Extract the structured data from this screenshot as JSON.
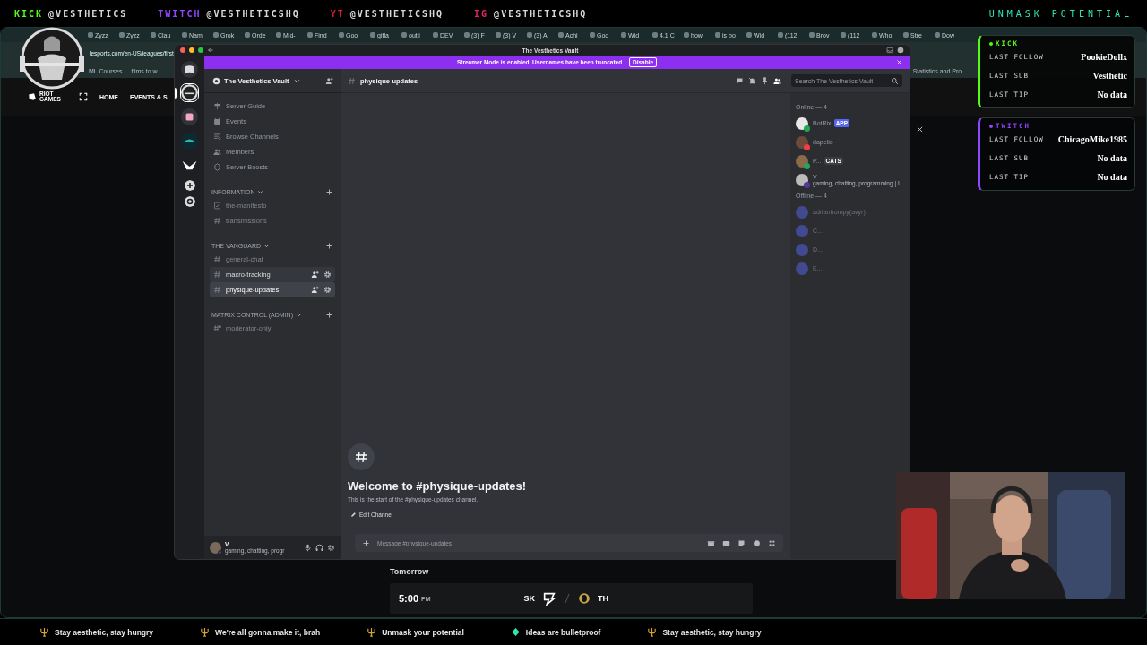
{
  "overlay_header": {
    "socials": [
      {
        "platform": "KICK",
        "handle": "@VESTHETICS",
        "color": "#53fc18"
      },
      {
        "platform": "TWITCH",
        "handle": "@VESTHETICSHQ",
        "color": "#9146ff"
      },
      {
        "platform": "YT",
        "handle": "@VESTHETICSHQ",
        "color": "#e0202a"
      },
      {
        "platform": "IG",
        "handle": "@VESTHETICSHQ",
        "color": "#e8206e"
      }
    ],
    "slogan": "UNMASK POTENTIAL"
  },
  "browser": {
    "tabs": [
      "Zyzz",
      "Zyzz",
      "Clau",
      "Nam",
      "Grok",
      "Orde",
      "Mid-",
      "Find",
      "Goo",
      "gitla",
      "outli",
      "DEV",
      "(3) F",
      "(3) V",
      "(3) A",
      "Achi",
      "Goo",
      "Wid",
      "4.1 C",
      "how",
      "is bo",
      "Wid",
      "(112",
      "Brov",
      "(112",
      "Who",
      "Stre",
      "Dow"
    ],
    "address": "lesports.com/en-US/leagues/first",
    "bookmarks": [
      "ML Courses",
      "films to w"
    ],
    "bookmark_right": "Statistics and Pro...",
    "site_logo": "RIOT GAMES",
    "site_nav": [
      "HOME",
      "EVENTS & S"
    ],
    "schedule": {
      "day": "Tomorrow",
      "time": "5:00",
      "meridiem": "PM",
      "team_1": "SK",
      "team_2": "TH"
    }
  },
  "discord": {
    "title": "The Vesthetics Vault",
    "banner": {
      "text": "Streamer Mode is enabled. Usernames have been truncated.",
      "button": "Disable"
    },
    "servers": [
      {
        "kind": "avatar",
        "selected": true
      },
      {
        "kind": "pink",
        "selected": false
      },
      {
        "kind": "dolphin",
        "selected": false
      },
      {
        "kind": "bird",
        "selected": false
      }
    ],
    "server_name": "The Vesthetics Vault",
    "nav": [
      {
        "label": "Server Guide",
        "kind": "guide"
      },
      {
        "label": "Events",
        "kind": "events"
      },
      {
        "label": "Browse Channels",
        "kind": "browse"
      },
      {
        "label": "Members",
        "kind": "members"
      },
      {
        "label": "Server Boosts",
        "kind": "boosts"
      }
    ],
    "categories": [
      {
        "name": "INFORMATION",
        "channels": [
          {
            "name": "the-manifesto",
            "kind": "rules",
            "selected": false,
            "hovered": false
          },
          {
            "name": "transmissions",
            "kind": "text",
            "selected": false,
            "hovered": false
          }
        ]
      },
      {
        "name": "THE VANGUARD",
        "channels": [
          {
            "name": "general-chat",
            "kind": "text",
            "selected": false,
            "hovered": false
          },
          {
            "name": "macro-tracking",
            "kind": "text",
            "selected": false,
            "hovered": true
          },
          {
            "name": "physique-updates",
            "kind": "text",
            "selected": true,
            "hovered": false
          }
        ]
      },
      {
        "name": "MATRIX CONTROL (ADMIN)",
        "channels": [
          {
            "name": "moderator-only",
            "kind": "private",
            "selected": false,
            "hovered": false
          }
        ]
      }
    ],
    "user": {
      "name": "V",
      "status": "gaming, chatting, progr"
    },
    "chat": {
      "channel": "physique-updates",
      "search_placeholder": "Search The Vesthetics Vault",
      "welcome_title": "Welcome to #physique-updates!",
      "welcome_text": "This is the start of the #physique-updates channel.",
      "edit_button": "Edit Channel",
      "message_placeholder": "Message #physique-updates"
    },
    "member_groups": [
      {
        "label": "Online — 4",
        "members": [
          {
            "name": "BotRix",
            "badge": "APP",
            "color": "#23a55a",
            "offline": false
          },
          {
            "name": "dapelio",
            "color": "#f23f43",
            "offline": false
          },
          {
            "name": "P...",
            "badge": "CATS",
            "color": "#23a55a",
            "offline": false
          },
          {
            "name": "V",
            "activity": "gaming, chatting, programming | I",
            "color": "#593695",
            "offline": false
          }
        ]
      },
      {
        "label": "Offline — 4",
        "members": [
          {
            "name": "adriantrompy(avyr)",
            "offline": true
          },
          {
            "name": "C...",
            "offline": true
          },
          {
            "name": "D...",
            "offline": true
          },
          {
            "name": "K...",
            "offline": true
          }
        ]
      }
    ]
  },
  "alerts": [
    {
      "platform": "KICK",
      "color": "#53fc18",
      "rows": [
        {
          "label": "LAST FOLLOW",
          "value": "PookieDollx"
        },
        {
          "label": "LAST SUB",
          "value": "Vesthetic"
        },
        {
          "label": "LAST TIP",
          "value": "No data"
        }
      ]
    },
    {
      "platform": "TWITCH",
      "color": "#9146ff",
      "rows": [
        {
          "label": "LAST FOLLOW",
          "value": "ChicagoMike1985"
        },
        {
          "label": "LAST SUB",
          "value": "No data"
        },
        {
          "label": "LAST TIP",
          "value": "No data"
        }
      ]
    }
  ],
  "ticker": [
    {
      "text": "Stay aesthetic, stay hungry",
      "kind": "trident"
    },
    {
      "text": "We're all gonna make it, brah",
      "kind": "trident"
    },
    {
      "text": "Unmask your potential",
      "kind": "trident"
    },
    {
      "text": "Ideas are bulletproof",
      "kind": "diamond"
    },
    {
      "text": "Stay aesthetic, stay hungry",
      "kind": "trident"
    }
  ]
}
